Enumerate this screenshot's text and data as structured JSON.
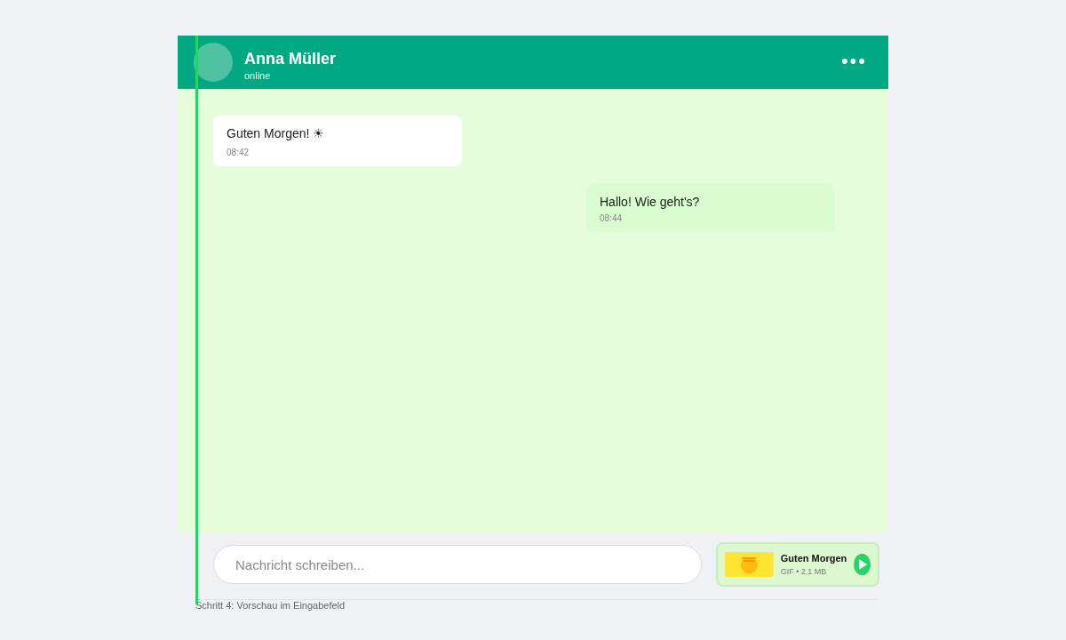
{
  "header": {
    "name": "Anna Müller",
    "status": "online",
    "menu": "•••"
  },
  "messages": [
    {
      "kind": "incoming",
      "text": "Guten Morgen! ☀",
      "time": "08:42"
    },
    {
      "kind": "outgoing",
      "text": "Hallo! Wie geht's?",
      "time": "08:44"
    }
  ],
  "composer": {
    "placeholder": "Nachricht schreiben..."
  },
  "attachment": {
    "title": "Guten Morgen",
    "meta": "GIF • 2.1 MB"
  },
  "caption": "Schritt 4: Vorschau im Eingabefeld"
}
